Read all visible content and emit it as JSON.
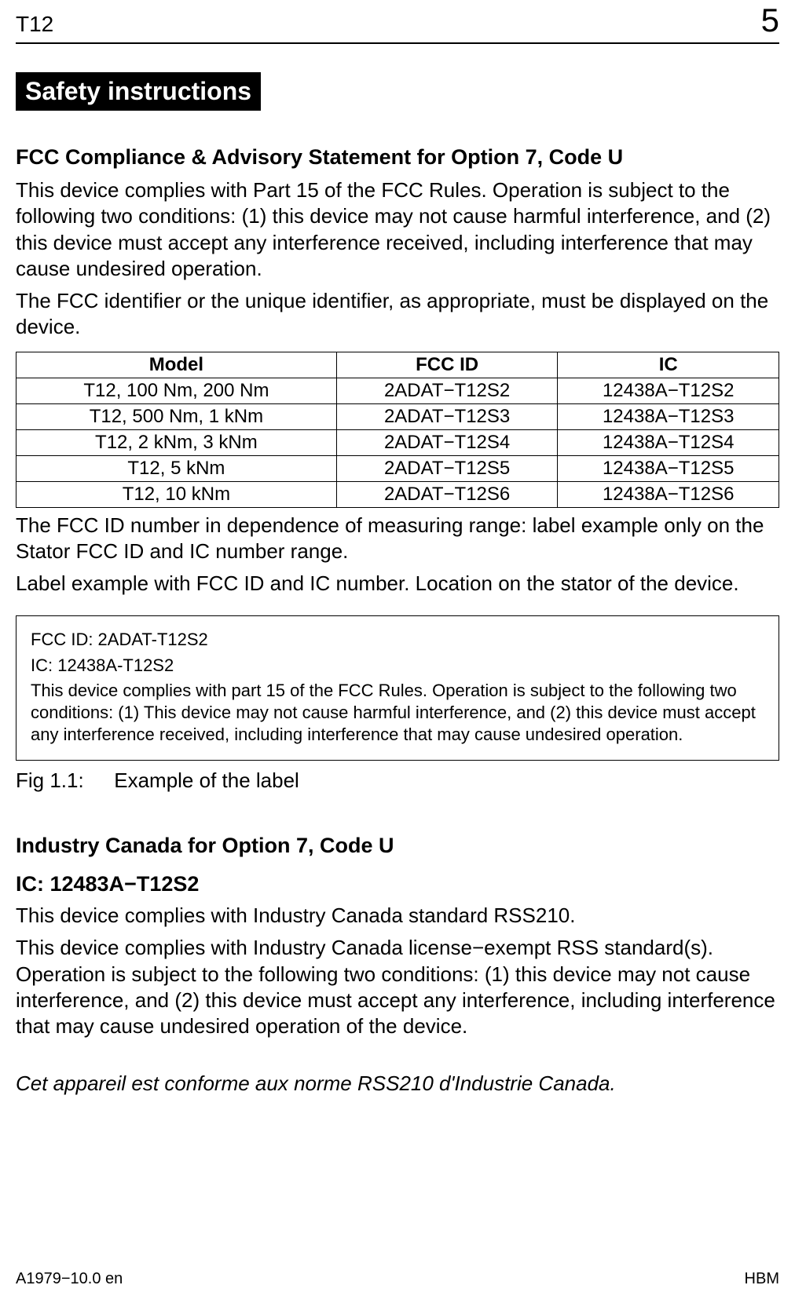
{
  "header": {
    "left": "T12",
    "right": "5"
  },
  "banner": "Safety instructions",
  "fcc": {
    "title": "FCC Compliance & Advisory Statement for Option 7, Code U",
    "para1": "This device complies with Part 15 of the FCC Rules. Operation is subject to the following two conditions: (1) this device may not cause harmful interference, and (2) this device must accept any interference received, including interference that may cause undesired operation.",
    "para2": "The FCC identifier or the unique identifier, as appropriate, must be displayed on the device."
  },
  "table": {
    "headers": {
      "c1": "Model",
      "c2": "FCC ID",
      "c3": "IC"
    },
    "rows": [
      {
        "c1": "T12, 100 Nm, 200 Nm",
        "c2": "2ADAT−T12S2",
        "c3": "12438A−T12S2"
      },
      {
        "c1": "T12, 500 Nm, 1 kNm",
        "c2": "2ADAT−T12S3",
        "c3": "12438A−T12S3"
      },
      {
        "c1": "T12, 2 kNm, 3 kNm",
        "c2": "2ADAT−T12S4",
        "c3": "12438A−T12S4"
      },
      {
        "c1": "T12, 5 kNm",
        "c2": "2ADAT−T12S5",
        "c3": "12438A−T12S5"
      },
      {
        "c1": "T12, 10 kNm",
        "c2": "2ADAT−T12S6",
        "c3": "12438A−T12S6"
      }
    ]
  },
  "after_table": {
    "para1": "The FCC ID number in dependence of measuring range: label example only on the Stator FCC ID and IC number range.",
    "para2": "Label example with FCC ID and IC number. Location on the stator of the device."
  },
  "label_box": {
    "line1": "FCC ID: 2ADAT-T12S2",
    "line2": "IC: 12438A-T12S2",
    "text": "This device complies with part 15 of the FCC Rules. Operation is subject to the following two conditions: (1) This device may not cause harmful interference, and (2) this device must accept any interference received, including interference that may cause undesired operation."
  },
  "fig": {
    "num": "Fig 1.1:",
    "text": "Example of the label"
  },
  "industry_canada": {
    "title": "Industry Canada for Option 7, Code U",
    "ic_heading": "IC: 12483A−T12S2",
    "para1": "This device complies with Industry Canada standard RSS210.",
    "para2": "This device complies with Industry Canada license−exempt RSS standard(s). Operation is subject to the following two conditions: (1) this device may not cause interference, and (2) this device must accept any interference, including interference that may cause undesired operation of the device.",
    "french": "Cet appareil est conforme aux norme RSS210 d'Industrie Canada."
  },
  "footer": {
    "left": "A1979−10.0 en",
    "right": "HBM"
  }
}
